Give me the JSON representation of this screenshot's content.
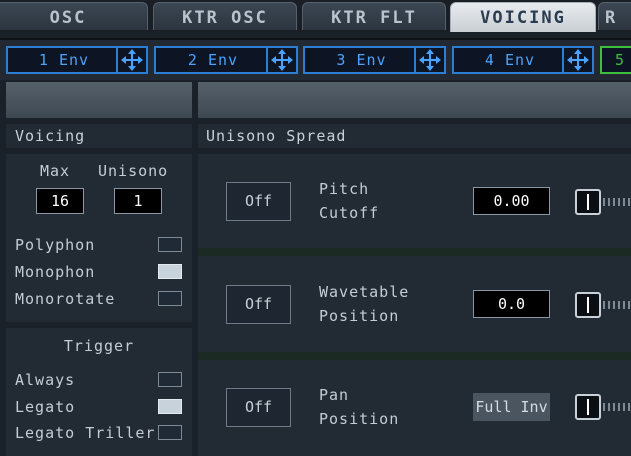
{
  "tabs": [
    {
      "label": "OSC",
      "active": false
    },
    {
      "label": "KTR OSC",
      "active": false
    },
    {
      "label": "KTR FLT",
      "active": false
    },
    {
      "label": "VOICING",
      "active": true
    },
    {
      "label": "R",
      "active": false
    }
  ],
  "env_slots": [
    {
      "label": "1 Env"
    },
    {
      "label": "2 Env"
    },
    {
      "label": "3 Env"
    },
    {
      "label": "4 Env"
    },
    {
      "label": "5"
    }
  ],
  "voicing": {
    "title": "Voicing",
    "max_label": "Max",
    "max_value": "16",
    "unisono_label": "Unisono",
    "unisono_value": "1",
    "modes": [
      {
        "label": "Polyphon",
        "checked": false
      },
      {
        "label": "Monophon",
        "checked": true
      },
      {
        "label": "Monorotate",
        "checked": false
      }
    ]
  },
  "trigger": {
    "title": "Trigger",
    "options": [
      {
        "label": "Always",
        "checked": false
      },
      {
        "label": "Legato",
        "checked": true
      },
      {
        "label": "Legato Triller",
        "checked": false
      }
    ]
  },
  "unisono_spread": {
    "title": "Unisono Spread",
    "rows": [
      {
        "button": "Off",
        "label_line1": "Pitch",
        "label_line2": "Cutoff",
        "value": "0.00"
      },
      {
        "button": "Off",
        "label_line1": "Wavetable",
        "label_line2": "Position",
        "value": "0.0"
      },
      {
        "button": "Off",
        "label_line1": "Pan",
        "label_line2": "Position",
        "value": "Full Inv"
      }
    ]
  },
  "colors": {
    "accent_blue": "#2a7fd3",
    "accent_green": "#3fbf3f",
    "active_tab": "#dfe4e8"
  }
}
